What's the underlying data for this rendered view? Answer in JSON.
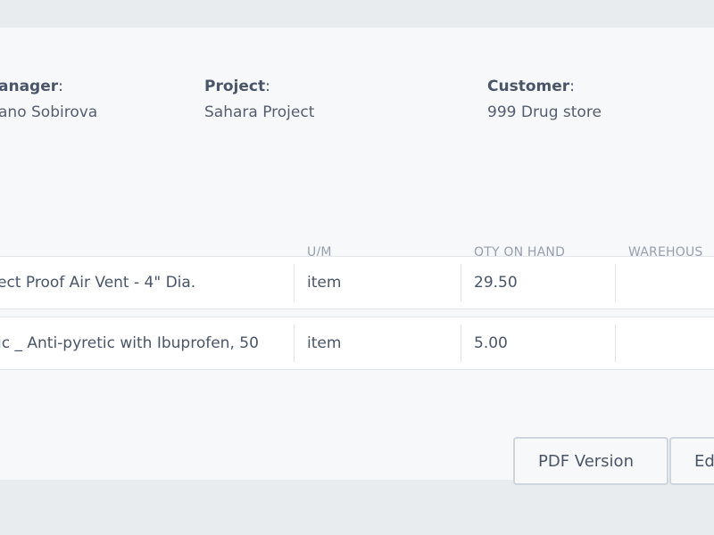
{
  "info": {
    "manager": {
      "label": "anager",
      "colon": ":",
      "value": "ano Sobirova"
    },
    "project": {
      "label": "Project",
      "colon": ":",
      "value": "Sahara Project"
    },
    "customer": {
      "label": "Customer",
      "colon": ":",
      "value": "999 Drug store"
    }
  },
  "table": {
    "headers": {
      "um": "U/M",
      "qty": "QTY ON HAND",
      "warehouse": "WAREHOUS"
    },
    "rows": [
      {
        "name": "ect Proof Air Vent - 4\" Dia.",
        "um": "item",
        "qty": "29.50"
      },
      {
        "name": "ic _ Anti-pyretic with Ibuprofen, 50",
        "um": "item",
        "qty": "5.00"
      }
    ]
  },
  "actions": {
    "pdf_label": "PDF Version",
    "edit_label": "Ed"
  },
  "colors": {
    "background": "#e9ecef",
    "card": "#f7f8fa",
    "row": "#ffffff",
    "border": "#cfd5dc"
  }
}
